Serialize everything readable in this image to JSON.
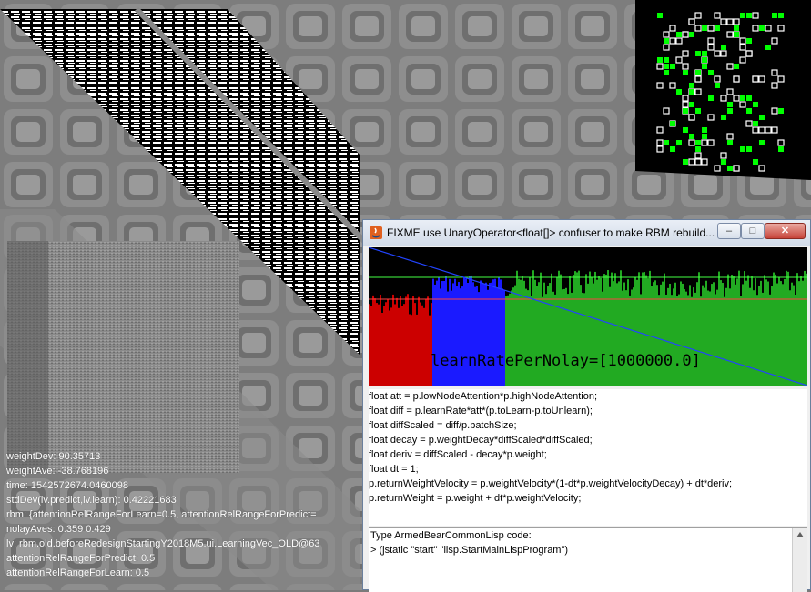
{
  "overlay_lines": [
    "weightDev: 90.35713",
    "weightAve: -38.768196",
    "time: 1542572674.0460098",
    "stdDev(lv.predict,lv.learn): 0.42221683",
    "rbm: {attentionRelRangeForLearn=0.5, attentionRelRangeForPredict=",
    "nolayAves: 0.359 0.429",
    "lv: rbm.old.beforeRedesignStartingY2018M5.ui.LearningVec_OLD@63",
    "attentionRelRangeForPredict: 0.5",
    "attentionRelRangeForLearn: 0.5"
  ],
  "window": {
    "title": "FIXME use UnaryOperator<float[]> confuser to make RBM rebuild...",
    "buttons": {
      "minimize": "–",
      "maximize": "□",
      "close": "✕"
    },
    "chart_label": "learnRatePerNolay=[1000000.0]",
    "code_lines": [
      "float att = p.lowNodeAttention*p.highNodeAttention;",
      "float diff = p.learnRate*att*(p.toLearn-p.toUnlearn);",
      "float diffScaled = diff/p.batchSize;",
      "float decay = p.weightDecay*diffScaled*diffScaled;",
      "float deriv = diffScaled - decay*p.weight;",
      "float dt = 1;",
      "p.returnWeightVelocity = p.weightVelocity*(1-dt*p.weightVelocityDecay) + dt*deriv;",
      "p.returnWeight = p.weight + dt*p.weightVelocity;"
    ],
    "console_lines": [
      "Type ArmedBearCommonLisp code:",
      "> (jstatic \"start\" \"lisp.StartMainLispProgram\")"
    ]
  },
  "colors": {
    "red": "#cc0000",
    "blue": "#1a1aff",
    "green": "#22aa22",
    "accent_green": "#00ff00"
  }
}
